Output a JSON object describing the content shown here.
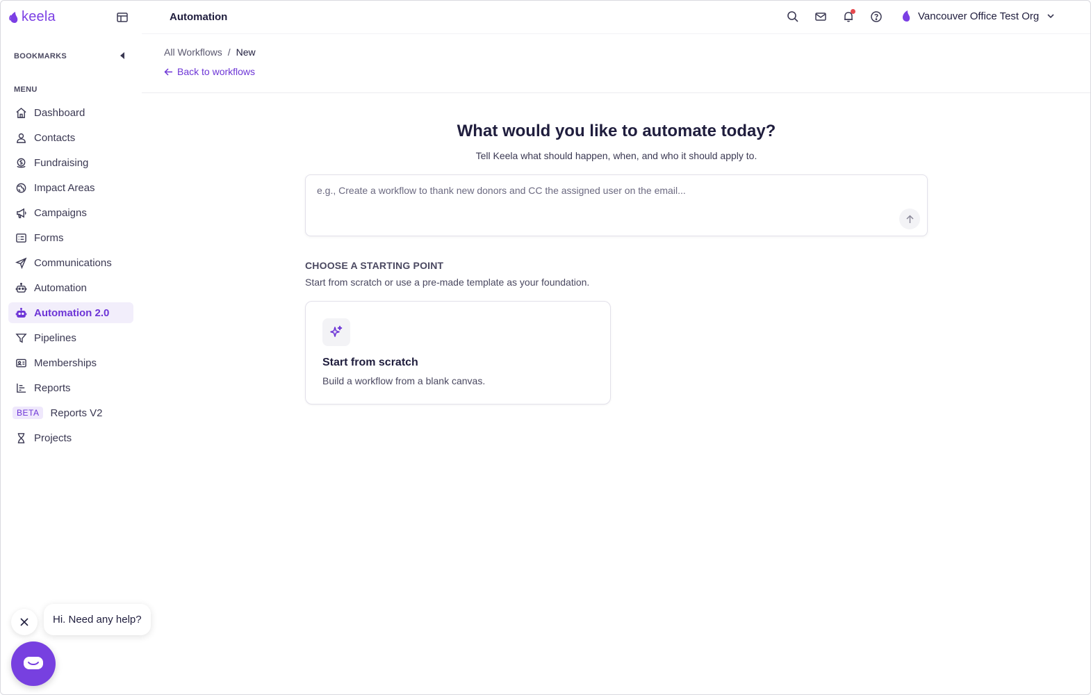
{
  "app": {
    "logo_text": "keela",
    "section_title": "Automation",
    "org_name": "Vancouver Office Test Org"
  },
  "colors": {
    "brand": "#7b3fe4",
    "active_bg": "#f2eefb",
    "notification": "#e5484d"
  },
  "top_icons": [
    "search-icon",
    "mail-icon",
    "bell-icon",
    "help-icon"
  ],
  "sidebar": {
    "bookmarks_heading": "BOOKMARKS",
    "menu_heading": "MENU",
    "items": [
      {
        "label": "Dashboard",
        "icon": "home-icon"
      },
      {
        "label": "Contacts",
        "icon": "user-icon"
      },
      {
        "label": "Fundraising",
        "icon": "coin-icon"
      },
      {
        "label": "Impact Areas",
        "icon": "globe-icon"
      },
      {
        "label": "Campaigns",
        "icon": "megaphone-icon"
      },
      {
        "label": "Forms",
        "icon": "form-icon"
      },
      {
        "label": "Communications",
        "icon": "send-icon"
      },
      {
        "label": "Automation",
        "icon": "robot-icon"
      },
      {
        "label": "Automation 2.0",
        "icon": "robot-icon",
        "active": true
      },
      {
        "label": "Pipelines",
        "icon": "filter-icon"
      },
      {
        "label": "Memberships",
        "icon": "id-card-icon"
      },
      {
        "label": "Reports",
        "icon": "chart-icon"
      },
      {
        "label": "Reports V2",
        "badge": "BETA"
      },
      {
        "label": "Projects",
        "icon": "hourglass-icon"
      }
    ]
  },
  "header": {
    "breadcrumb_root": "All Workflows",
    "breadcrumb_sep": "/",
    "breadcrumb_current": "New",
    "back_label": "Back to workflows"
  },
  "main": {
    "title": "What would you like to automate today?",
    "subtitle": "Tell Keela what should happen, when, and who it should apply to.",
    "prompt_placeholder": "e.g., Create a workflow to thank new donors and CC the assigned user on the email...",
    "starting_title": "CHOOSE A STARTING POINT",
    "starting_sub": "Start from scratch or use a pre-made template as your foundation.",
    "card_title": "Start from scratch",
    "card_desc": "Build a workflow from a blank canvas."
  },
  "chat": {
    "greeting": "Hi. Need any help?"
  }
}
